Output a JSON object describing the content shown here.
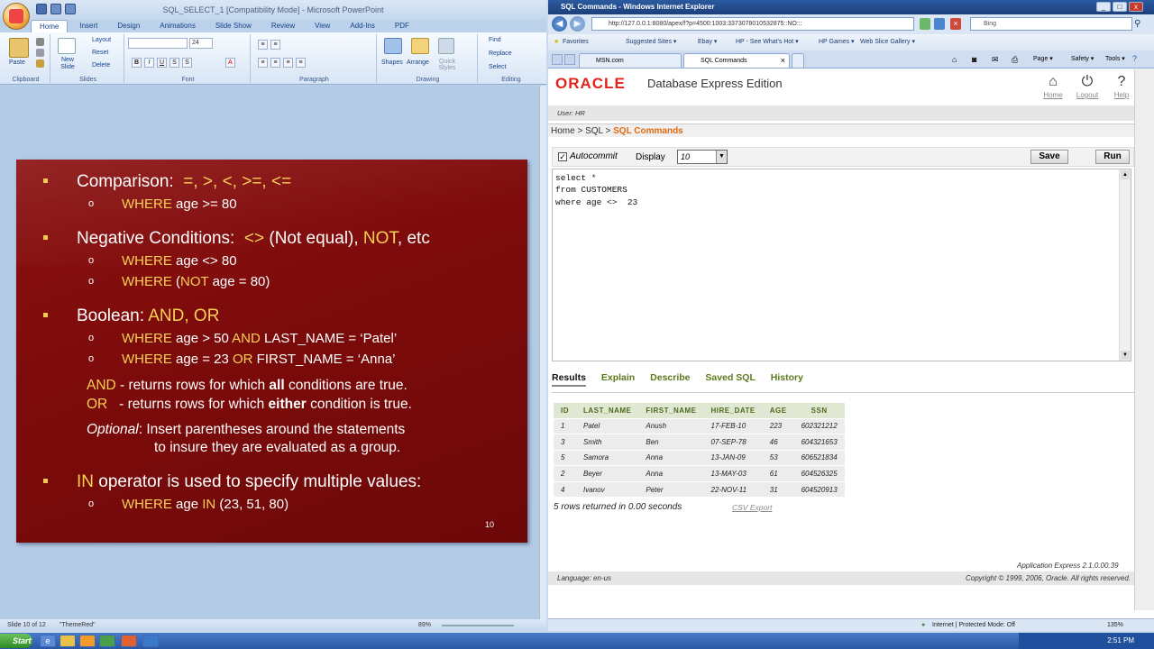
{
  "ppt": {
    "title": "SQL_SELECT_1 [Compatibility Mode] - Microsoft PowerPoint",
    "tabs": [
      "Home",
      "Insert",
      "Design",
      "Animations",
      "Slide Show",
      "Review",
      "View",
      "Add-Ins",
      "PDF"
    ],
    "groups": {
      "clipboard": "Clipboard",
      "slides": "Slides",
      "font": "Font",
      "paragraph": "Paragraph",
      "drawing": "Drawing",
      "editing": "Editing"
    },
    "buttons": {
      "paste": "Paste",
      "new_slide": "New Slide",
      "layout": "Layout",
      "reset": "Reset",
      "delete": "Delete",
      "shapes": "Shapes",
      "arrange": "Arrange",
      "quick_styles": "Quick Styles",
      "find": "Find",
      "replace": "Replace",
      "select": "Select"
    },
    "font_size": "24",
    "slide": {
      "b1": "Comparison:",
      "b1y": "=, >, <, >=, <=",
      "b1s1y": "WHERE",
      "b1s1": " age >= 80",
      "b2": "Negative Conditions:",
      "b2y1": "<>",
      "b2t1": " (Not equal), ",
      "b2y2": "NOT",
      "b2t2": ", etc",
      "b2s1y": "WHERE",
      "b2s1": " age <> 80",
      "b2s2y": "WHERE",
      "b2s2a": " (",
      "b2s2y2": "NOT",
      "b2s2b": " age = 80)",
      "b3": "Boolean: ",
      "b3y": "AND, OR",
      "b3s1y": "WHERE",
      "b3s1a": " age > 50 ",
      "b3s1y2": "AND",
      "b3s1b": " LAST_NAME = ‘Patel’",
      "b3s2y": "WHERE",
      "b3s2a": " age = 23 ",
      "b3s2y2": "OR",
      "b3s2b": " FIRST_NAME = ‘Anna’",
      "and_y": "AND",
      "and_a": " - returns rows for which ",
      "and_b": "all",
      "and_c": " conditions are true.",
      "or_y": "OR",
      "or_a": "   - returns rows for which ",
      "or_b": "either",
      "or_c": " condition is true.",
      "opt_i": "Optional",
      "opt_a": ": Insert parentheses around the statements",
      "opt_b": "to insure they are evaluated as a group.",
      "b4y": "IN",
      "b4": " operator is used to specify multiple values:",
      "b4s1y": "WHERE",
      "b4s1a": " age ",
      "b4s1y2": "IN",
      "b4s1b": " (23, 51, 80)",
      "page": "10"
    },
    "status": {
      "slide": "Slide 10 of 12",
      "theme": "\"ThemeRed\"",
      "zoom": "89%"
    }
  },
  "ie": {
    "title": "SQL Commands - Windows Internet Explorer",
    "url": "http://127.0.0.1:8080/apex/f?p=4500:1003:3373078010532875::NO:::",
    "search": "Bing",
    "favorites": "Favorites",
    "fav_items": [
      "Suggested Sites ▾",
      "Ebay ▾",
      "HP - See What's Hot ▾",
      "HP Games ▾",
      "Web Slice Gallery ▾"
    ],
    "tabs": [
      "MSN.com",
      "SQL Commands"
    ],
    "cmd_items": [
      "Page ▾",
      "Safety ▾",
      "Tools ▾"
    ],
    "status_zone": "Internet | Protected Mode: Off",
    "status_zoom": "135%"
  },
  "apex": {
    "brand": "ORACLE",
    "product": "Database Express Edition",
    "nav": [
      "Home",
      "Logout",
      "Help"
    ],
    "user": "User: HR",
    "crumb_home": "Home",
    "crumb_sep": " > ",
    "crumb_sql": "SQL",
    "crumb_current": "SQL Commands",
    "autocommit": "Autocommit",
    "display_label": "Display",
    "display_value": "10",
    "save": "Save",
    "run": "Run",
    "sql_text": "select *\nfrom CUSTOMERS\nwhere age <>  23",
    "result_tabs": [
      "Results",
      "Explain",
      "Describe",
      "Saved SQL",
      "History"
    ],
    "columns": [
      "ID",
      "LAST_NAME",
      "FIRST_NAME",
      "HIRE_DATE",
      "AGE",
      "SSN"
    ],
    "rows": [
      [
        "1",
        "Patel",
        "Anush",
        "17-FEB-10",
        "223",
        "602321212"
      ],
      [
        "3",
        "Smith",
        "Ben",
        "07-SEP-78",
        "46",
        "604321653"
      ],
      [
        "5",
        "Samora",
        "Anna",
        "13-JAN-09",
        "53",
        "606521834"
      ],
      [
        "2",
        "Beyer",
        "Anna",
        "13-MAY-03",
        "61",
        "604526325"
      ],
      [
        "4",
        "Ivanov",
        "Peter",
        "22-NOV-11",
        "31",
        "604520913"
      ]
    ],
    "rows_msg": "5 rows returned in 0.00 seconds",
    "csv": "CSV Export",
    "version": "Application Express 2.1.0.00.39",
    "language": "Language: en-us",
    "copyright": "Copyright © 1999, 2006, Oracle. All rights reserved."
  },
  "taskbar": {
    "start": "Start",
    "clock": "2:51 PM"
  }
}
